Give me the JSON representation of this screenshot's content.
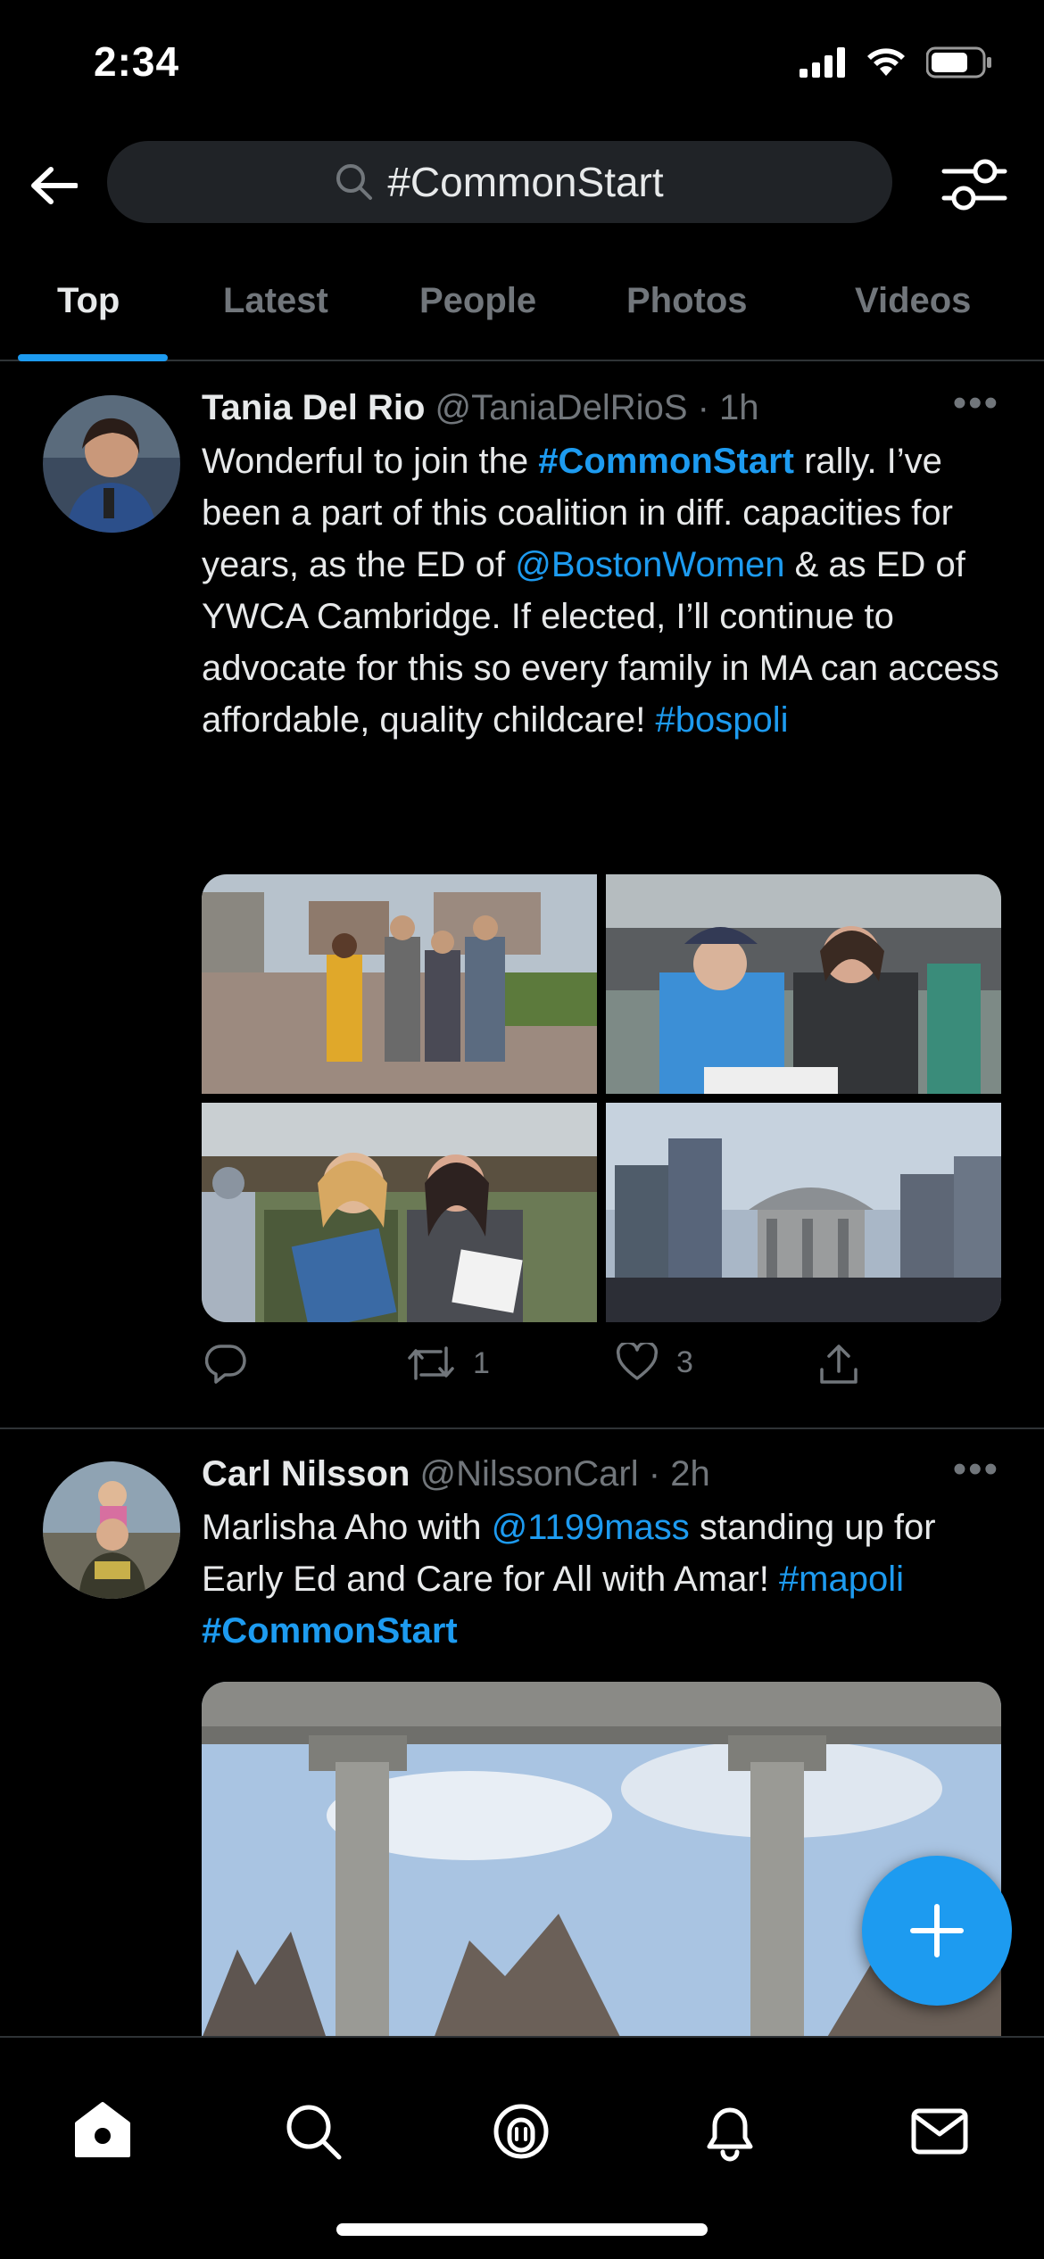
{
  "status_bar": {
    "time": "2:34"
  },
  "search": {
    "query": "#CommonStart"
  },
  "tabs": [
    {
      "label": "Top",
      "active": true
    },
    {
      "label": "Latest",
      "active": false
    },
    {
      "label": "People",
      "active": false
    },
    {
      "label": "Photos",
      "active": false
    },
    {
      "label": "Videos",
      "active": false
    }
  ],
  "tweets": [
    {
      "name": "Tania Del Rio",
      "handle": "@TaniaDelRioS",
      "time": "· 1h",
      "text_parts": {
        "p1": "Wonderful to join the ",
        "tag1": "#CommonStart",
        "p2": " rally. I’ve been a part of this coalition in diff. capacities for years, as the ED of ",
        "mention": "@BostonWomen",
        "p3": " & as ED of YWCA Cambridge. If elected, I’ll continue to advocate for this so every family in MA can access affordable, quality childcare! ",
        "tag2": "#bospoli"
      },
      "retweets": "1",
      "likes": "3"
    },
    {
      "name": "Carl Nilsson",
      "handle": "@NilssonCarl",
      "time": "· 2h",
      "text_parts": {
        "p1": "Marlisha Aho with ",
        "mention": "@1199mass",
        "p2": " standing up for Early Ed and Care for All with Amar! ",
        "tag1": "#mapoli",
        "tag2": "#CommonStart"
      }
    }
  ],
  "colors": {
    "accent": "#1d9bf0",
    "muted": "#71767b",
    "background": "#000000"
  }
}
